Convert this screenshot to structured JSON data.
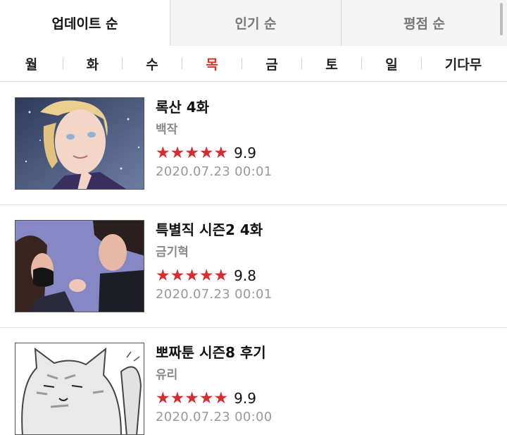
{
  "sort_tabs": [
    {
      "label": "업데이트 순",
      "active": true
    },
    {
      "label": "인기 순",
      "active": false
    },
    {
      "label": "평점 순",
      "active": false
    }
  ],
  "day_tabs": [
    {
      "label": "월"
    },
    {
      "label": "화"
    },
    {
      "label": "수"
    },
    {
      "label": "목",
      "active": true
    },
    {
      "label": "금"
    },
    {
      "label": "토"
    },
    {
      "label": "일"
    },
    {
      "label": "기다무"
    }
  ],
  "comics": [
    {
      "title": "록산 4화",
      "author": "백작",
      "rating": "9.9",
      "stars": 5,
      "date": "2020.07.23 00:01"
    },
    {
      "title": "특별직 시즌2 4화",
      "author": "금기혁",
      "rating": "9.8",
      "stars": 5,
      "date": "2020.07.23 00:01"
    },
    {
      "title": "뽀짜툰 시즌8 후기",
      "author": "유리",
      "rating": "9.9",
      "stars": 5,
      "date": "2020.07.23 00:00"
    }
  ],
  "colors": {
    "accent": "#e0322a",
    "star": "#d62e2e"
  }
}
